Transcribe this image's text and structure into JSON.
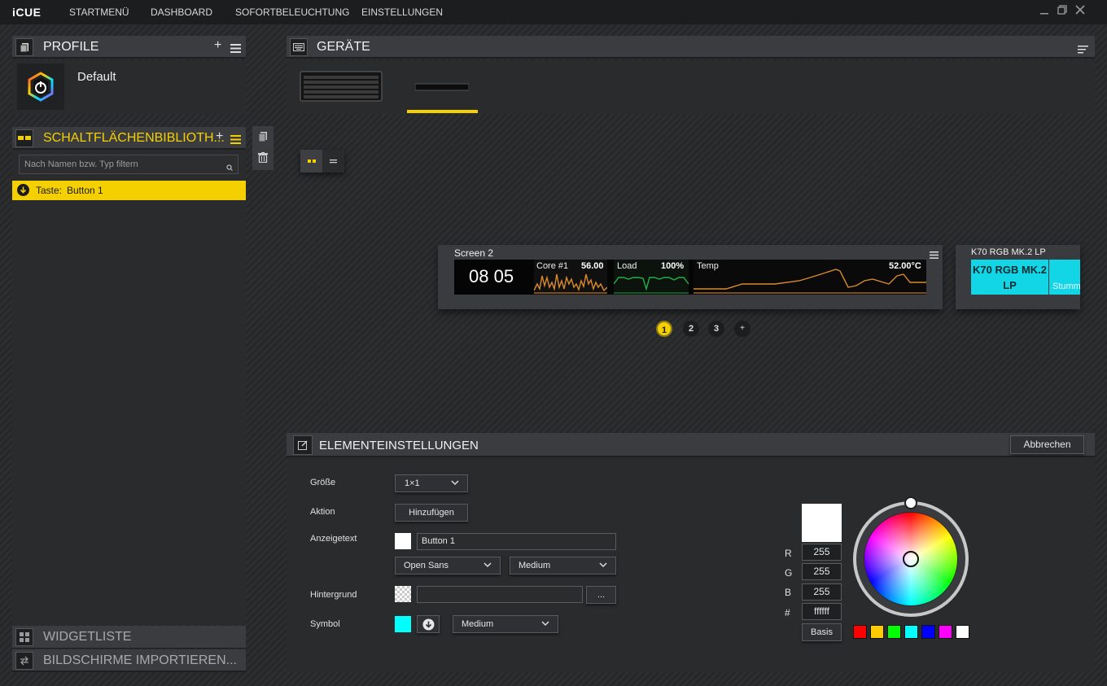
{
  "app": {
    "logo": "iCUE"
  },
  "nav": [
    "STARTMENÜ",
    "DASHBOARD",
    "SOFORTBELEUCHTUNG",
    "EINSTELLUNGEN"
  ],
  "profiles": {
    "title": "PROFILE",
    "profile_name": "Default"
  },
  "library": {
    "title": "SCHALTFLÄCHENBIBLIOTH...",
    "filter_placeholder": "Nach Namen bzw. Typ filtern",
    "item_type": "Taste:",
    "item_name": "Button 1"
  },
  "bottom_panels": {
    "widgets": "WIDGETLISTE",
    "import": "BILDSCHIRME IMPORTIEREN..."
  },
  "devices": {
    "title": "GERÄTE"
  },
  "screen": {
    "name": "Screen 2",
    "clock": "08 05",
    "core_label": "Core #1",
    "core_value": "56.00",
    "load_label": "Load",
    "load_value": "100%",
    "temp_label": "Temp",
    "temp_value": "52.00°C"
  },
  "second_device": {
    "name": "K70 RGB MK.2 LP",
    "tile_text": "K70 RGB MK.2 LP",
    "tile_sub": "Stumm"
  },
  "pages": [
    "1",
    "2",
    "3",
    "+"
  ],
  "element_settings": {
    "title": "ELEMENTEINSTELLUNGEN",
    "cancel": "Abbrechen",
    "size_label": "Größe",
    "size_value": "1×1",
    "action_label": "Aktion",
    "action_button": "Hinzufügen",
    "display_text_label": "Anzeigetext",
    "display_text_value": "Button 1",
    "font_value": "Open Sans",
    "font_weight": "Medium",
    "background_label": "Hintergrund",
    "browse_button": "...",
    "symbol_label": "Symbol",
    "symbol_size": "Medium"
  },
  "color_picker": {
    "r_label": "R",
    "r": "255",
    "g_label": "G",
    "g": "255",
    "b_label": "B",
    "b": "255",
    "hex_label": "#",
    "hex": "ffffff",
    "basis_button": "Basis",
    "current_color": "#ffffff",
    "swatches": [
      "#ff0000",
      "#ffcc00",
      "#00ff00",
      "#00ffff",
      "#0000ff",
      "#ff00ff",
      "#ffffff"
    ]
  },
  "colors": {
    "accent": "#f5d000",
    "cyan_tile": "#12d6e6",
    "graph_orange": "#d98b2b",
    "graph_green": "#23b04a"
  }
}
